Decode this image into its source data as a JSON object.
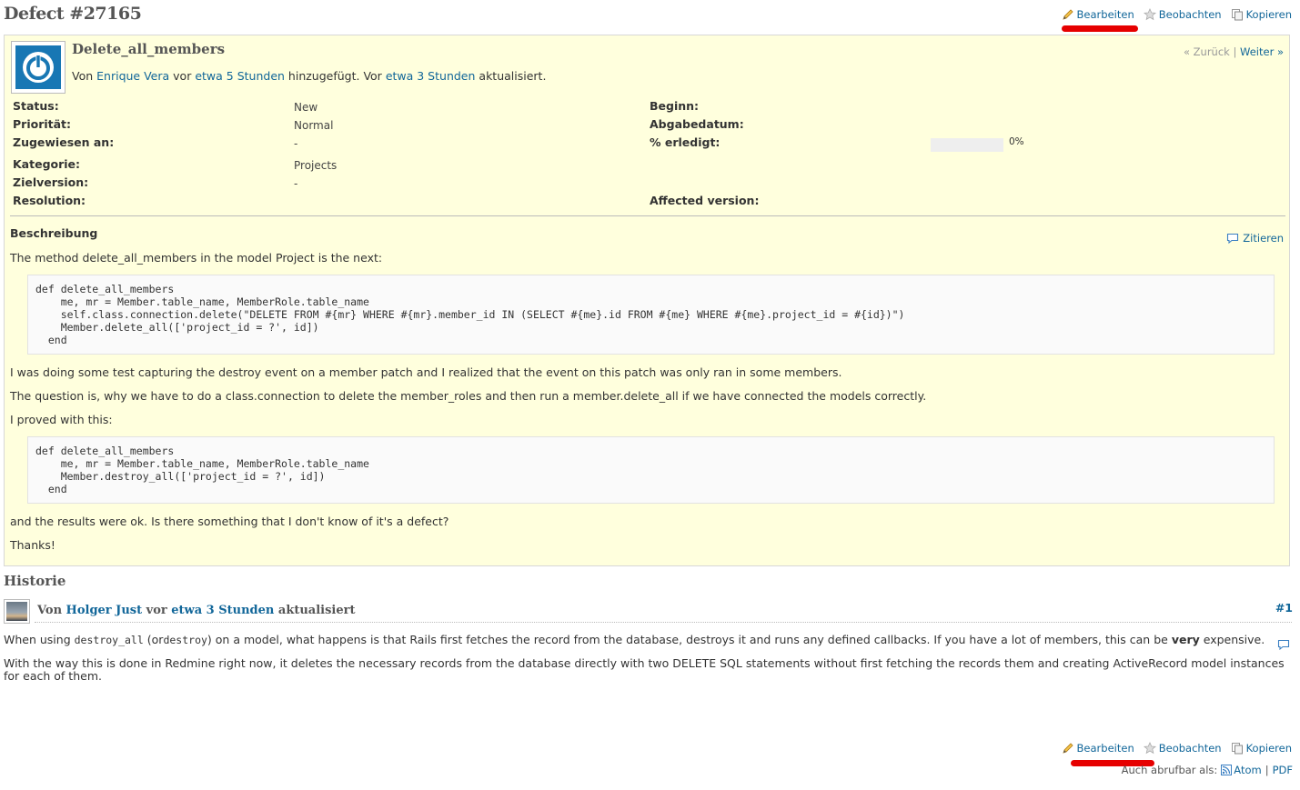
{
  "issue": {
    "title": "Defect #27165",
    "subject": "Delete_all_members",
    "author_prefix": "Von",
    "author": "Enrique Vera",
    "vor1": "vor",
    "added_time": "etwa 5 Stunden",
    "added_mid": "hinzugefügt. Vor",
    "updated_time": "etwa 3 Stunden",
    "updated_suffix": "aktualisiert.",
    "prev": "« Zurück",
    "separator": "|",
    "next": "Weiter »"
  },
  "actions": {
    "edit": "Bearbeiten",
    "watch": "Beobachten",
    "copy": "Kopieren"
  },
  "attributes": {
    "status_label": "Status:",
    "status_value": "New",
    "priority_label": "Priorität:",
    "priority_value": "Normal",
    "assigned_label": "Zugewiesen an:",
    "assigned_value": "-",
    "category_label": "Kategorie:",
    "category_value": "Projects",
    "target_label": "Zielversion:",
    "target_value": "-",
    "resolution_label": "Resolution:",
    "start_label": "Beginn:",
    "due_label": "Abgabedatum:",
    "done_label": "% erledigt:",
    "done_value": "0%",
    "done_fraction": 0,
    "affected_label": "Affected version:"
  },
  "description": {
    "title": "Beschreibung",
    "quote": "Zitieren",
    "p1": "The method delete_all_members in the model Project is the next:",
    "code1": "def delete_all_members\n    me, mr = Member.table_name, MemberRole.table_name\n    self.class.connection.delete(\"DELETE FROM #{mr} WHERE #{mr}.member_id IN (SELECT #{me}.id FROM #{me} WHERE #{me}.project_id = #{id})\")\n    Member.delete_all(['project_id = ?', id])\n  end",
    "p2": "I was doing some test capturing the destroy event on a member patch and I realized that the event on this patch was only ran in some members.",
    "p3": "The question is, why we have to do a class.connection to delete the member_roles and then run a member.delete_all if we have connected the models correctly.",
    "p4": "I proved with this:",
    "code2": "def delete_all_members\n    me, mr = Member.table_name, MemberRole.table_name\n    Member.destroy_all(['project_id = ?', id])\n  end",
    "p5": "and the results were ok. Is there something that I don't know of it's a defect?",
    "p6": "Thanks!"
  },
  "history": {
    "title": "Historie",
    "prefix": "Von",
    "author": "Holger Just",
    "vor": "vor",
    "time": "etwa 3 Stunden",
    "suffix": "aktualisiert",
    "number": "#1",
    "n1a": "When using",
    "n1code1": "destroy_all",
    "n1b": "(or",
    "n1code2": "destroy",
    "n1c": ") on a model, what happens is that Rails first fetches the record from the database, destroys it and runs any defined callbacks. If you have a lot of members, this can be",
    "n1bold": "very",
    "n1d": "expensive.",
    "n2": "With the way this is done in Redmine right now, it deletes the necessary records from the database directly with two DELETE SQL statements without first fetching the records them and creating ActiveRecord model instances for each of them."
  },
  "footer": {
    "also_as": "Auch abrufbar als:",
    "atom": "Atom",
    "sep": "|",
    "pdf": "PDF"
  },
  "colors": {
    "issue_bg": "#ffffdd",
    "link": "#116699",
    "highlight": "#e60000"
  }
}
